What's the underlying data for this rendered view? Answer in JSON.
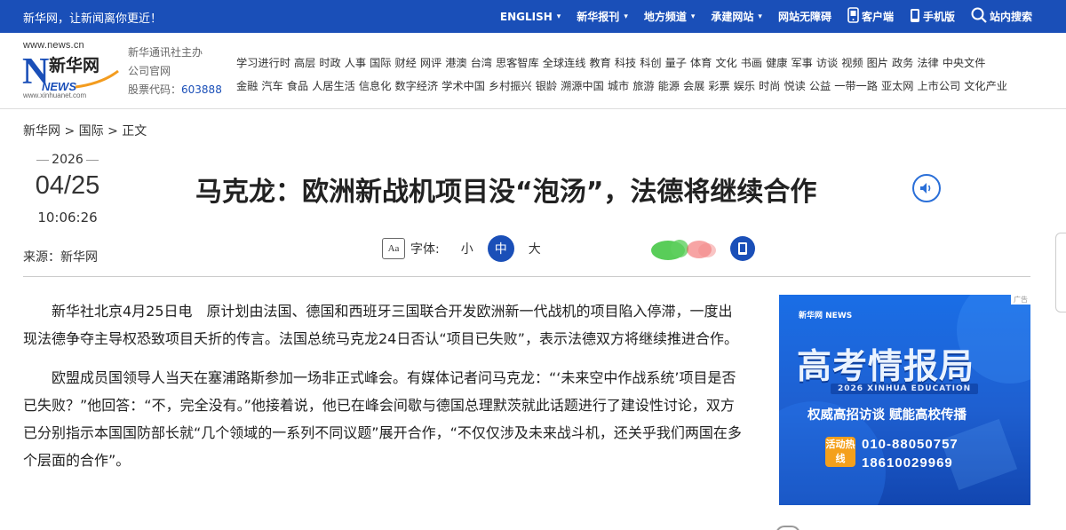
{
  "topbar": {
    "slogan": "新华网，让新闻离你更近！",
    "nav": [
      {
        "label": "ENGLISH",
        "caret": "▾"
      },
      {
        "label": "新华报刊",
        "caret": "▾"
      },
      {
        "label": "地方频道",
        "caret": "▾"
      },
      {
        "label": "承建网站",
        "caret": "▾"
      },
      {
        "label": "网站无障碍"
      },
      {
        "label": "客户端"
      },
      {
        "label": "手机版"
      },
      {
        "label": "站内搜索"
      }
    ]
  },
  "header": {
    "logo_url": "www.news.cn",
    "logo_text": "新华网",
    "logo_en": "NEWS",
    "logo_url2": "www.xinhuanet.com",
    "org_line1": "新华通讯社主办",
    "org_line2": "公司官网",
    "stock_label": "股票代码：",
    "stock_code": "603888",
    "channels_row1": [
      "学习进行时",
      "高层",
      "时政",
      "人事",
      "国际",
      "财经",
      "网评",
      "港澳",
      "台湾",
      "思客智库",
      "全球连线",
      "教育",
      "科技",
      "科创",
      "量子",
      "体育",
      "文化",
      "书画",
      "健康",
      "军事",
      "访谈",
      "视频",
      "图片",
      "政务",
      "法律",
      "中央文件"
    ],
    "channels_row2": [
      "金融",
      "汽车",
      "食品",
      "人居生活",
      "信息化",
      "数字经济",
      "学术中国",
      "乡村振兴",
      "银龄",
      "溯源中国",
      "城市",
      "旅游",
      "能源",
      "会展",
      "彩票",
      "娱乐",
      "时尚",
      "悦读",
      "公益",
      "一带一路",
      "亚太网",
      "上市公司",
      "文化产业"
    ]
  },
  "breadcrumb": {
    "home": "新华网",
    "sep1": " > ",
    "section": "国际",
    "sep2": " > ",
    "current": "正文"
  },
  "article_meta": {
    "year": "2026",
    "month_day": "04/25",
    "time": "10:06:26",
    "source": "来源：新华网"
  },
  "title": "马克龙：欧洲新战机项目没“泡汤”，法德将继续合作",
  "font_tool": {
    "icon_text": "Aa",
    "label": "字体:",
    "small": "小",
    "medium": "中",
    "large": "大"
  },
  "paragraphs": [
    "新华社北京4月25日电　原计划由法国、德国和西班牙三国联合开发欧洲新一代战机的项目陷入停滞，一度出现法德争夺主导权恐致项目夭折的传言。法国总统马克龙24日否认“项目已失败”，表示法德双方将继续推进合作。",
    "欧盟成员国领导人当天在塞浦路斯参加一场非正式峰会。有媒体记者问马克龙：“‘未来空中作战系统’项目是否已失败？”他回答：“不，完全没有。”他接着说，他已在峰会间歇与德国总理默茨就此话题进行了建设性讨论，双方已分别指示本国国防部长就“几个领域的一系列不同议题”展开合作，“不仅仅涉及未来战斗机，还关乎我们两国在多个层面的合作”。"
  ],
  "ad": {
    "tag": "广告",
    "logo": "新华网 NEWS",
    "headline": "高考情报局",
    "year_band": "2026 XINHUA EDUCATION",
    "sub": "权威高招访谈  赋能高校传播",
    "hotline": "活动热线",
    "phone1": "010-88050757",
    "phone2": "18610029969"
  },
  "colors": {
    "brand": "#1a4fb8",
    "ad_bg": "#1e5fd0",
    "hotline": "#f4a01c"
  }
}
